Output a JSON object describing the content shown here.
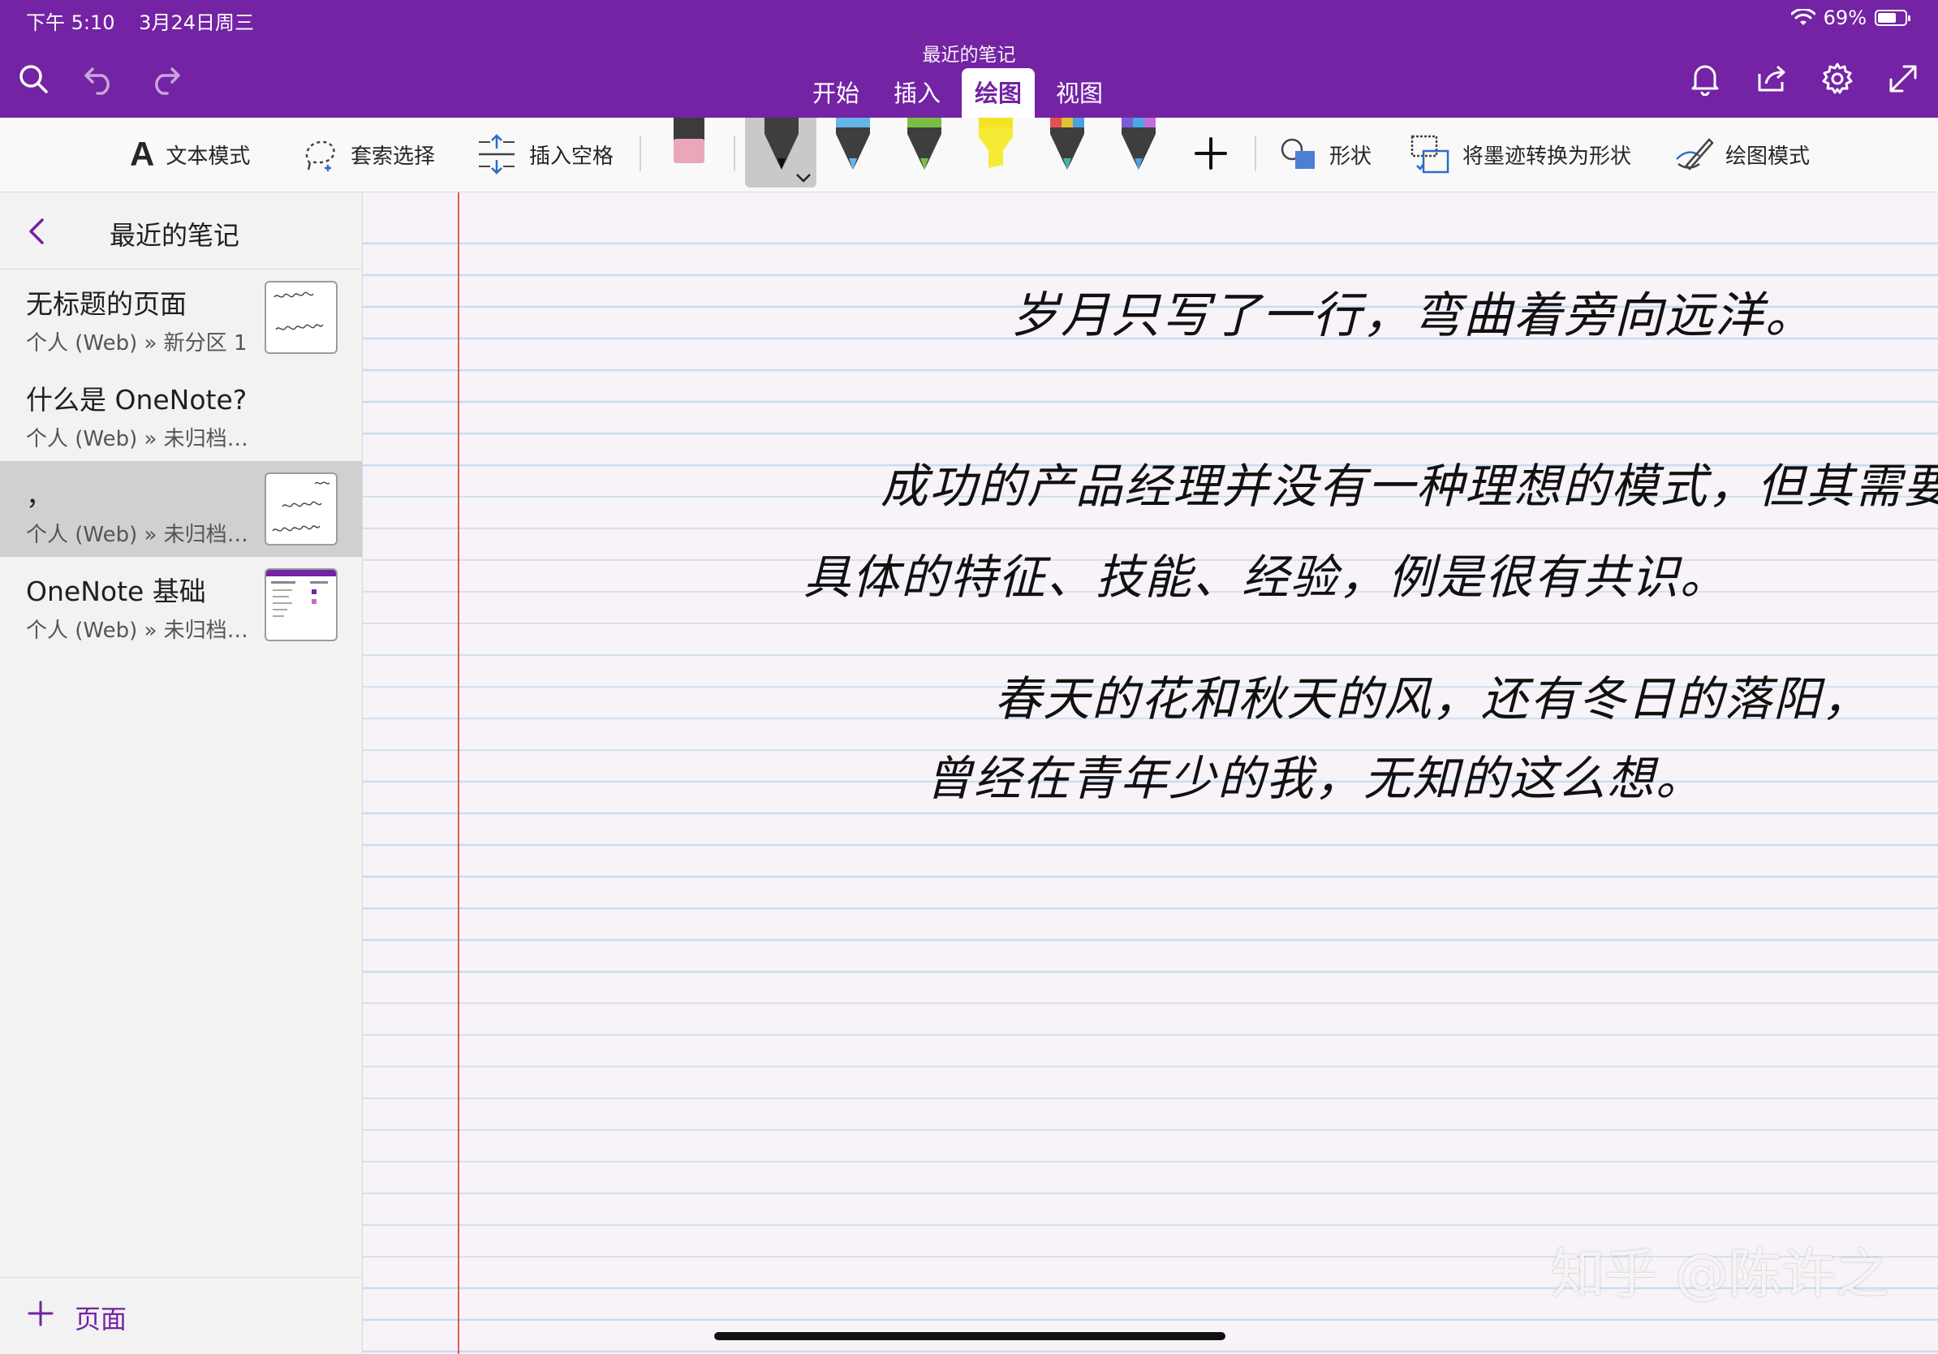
{
  "status": {
    "time": "下午 5:10",
    "date": "3月24日周三",
    "battery": "69%",
    "battery_level": 0.69
  },
  "app": {
    "title": "最近的笔记"
  },
  "tabs": [
    {
      "label": "开始",
      "active": false
    },
    {
      "label": "插入",
      "active": false
    },
    {
      "label": "绘图",
      "active": true
    },
    {
      "label": "视图",
      "active": false
    }
  ],
  "ribbon": {
    "text_mode": "文本模式",
    "lasso": "套索选择",
    "insert_space": "插入空格",
    "shapes": "形状",
    "ink_to_shape": "将墨迹转换为形状",
    "draw_mode": "绘图模式"
  },
  "colors": {
    "brand": "#7323a3",
    "margin": "#e05a5a",
    "rule": "#c9dcef",
    "page": "#f8f3f8"
  },
  "sidebar": {
    "title": "最近的笔记",
    "items": [
      {
        "title": "无标题的页面",
        "path": "个人 (Web) » 新分区 1",
        "selected": false
      },
      {
        "title": "什么是 OneNote?",
        "path": "个人 (Web) » 未归档笔记",
        "selected": false
      },
      {
        "title": "，",
        "path": "个人 (Web) » 未归档笔记",
        "selected": true
      },
      {
        "title": "OneNote 基础",
        "path": "个人 (Web) » 未归档笔记",
        "selected": false
      }
    ],
    "add_page": "页面"
  },
  "page": {
    "handwriting": [
      "岁月只写了一行，弯曲着旁向远洋。",
      "成功的产品经理并没有一种理想的模式，但其需要",
      "具体的特征、技能、经验，例是很有共识。",
      "春天的花和秋天的风，还有冬日的落阳，",
      "曾经在青年少的我，无知的这么想。"
    ]
  },
  "watermark": "知乎 @陈许之"
}
